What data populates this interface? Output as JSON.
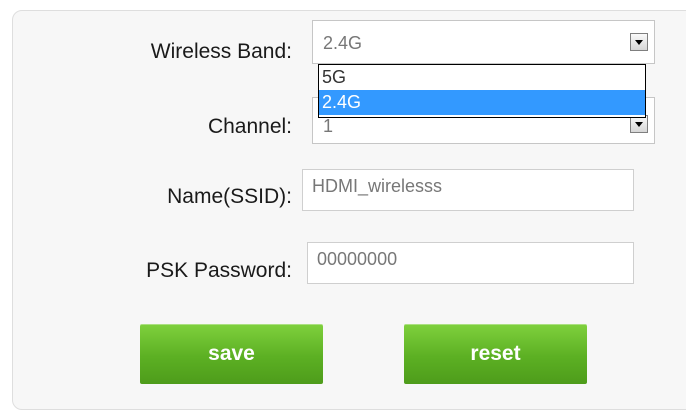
{
  "form": {
    "wireless_band": {
      "label": "Wireless Band:",
      "value": "2.4G",
      "options": [
        "5G",
        "2.4G"
      ],
      "selected_option": "2.4G"
    },
    "channel": {
      "label": "Channel:",
      "value": "1"
    },
    "ssid": {
      "label": "Name(SSID):",
      "value": "HDMI_wirelesss"
    },
    "psk_password": {
      "label": "PSK Password:",
      "value": "00000000"
    }
  },
  "buttons": {
    "save_label": "save",
    "reset_label": "reset"
  },
  "colors": {
    "button_green": "#5cb023",
    "selection_blue": "#3399ff"
  }
}
